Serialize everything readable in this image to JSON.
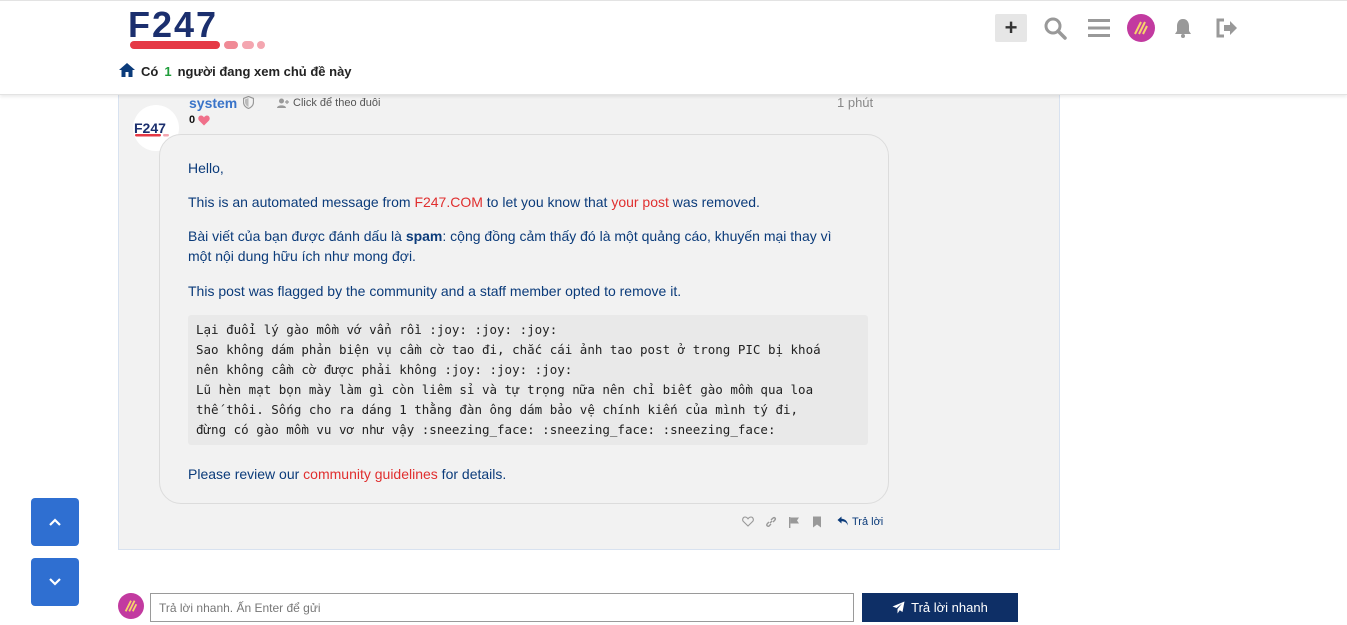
{
  "header": {
    "viewers_prefix": "Có",
    "viewers_count": "1",
    "viewers_suffix": "người đang xem chủ đề này",
    "icons": [
      "plus-icon",
      "search-icon",
      "menu-icon",
      "user-avatar",
      "bell-icon",
      "logout-icon"
    ],
    "plus_label": "+"
  },
  "post": {
    "username": "system",
    "follow_label": "Click để theo đuôi",
    "time": "1 phút",
    "likes": "0",
    "greeting": "Hello,",
    "msg1_a": "This is an automated message from ",
    "msg1_link1": "F247.COM",
    "msg1_b": " to let you know that ",
    "msg1_link2": "your post",
    "msg1_c": " was removed.",
    "msg2_a": "Bài viết của bạn được đánh dấu là ",
    "msg2_bold": "spam",
    "msg2_b": ": cộng đồng cảm thấy đó là một quảng cáo, khuyến mại thay vì",
    "msg2_c": "một nội dung hữu ích như mong đợi.",
    "msg3": "This post was flagged by the community and a staff member opted to remove it.",
    "quote": "Lại đuổi lý gào mồm vớ vẩn rồi :joy: :joy: :joy:\nSao không dám phản biện vụ cầm cờ tao đi, chắc cái ảnh tao post ở trong PIC bị khoá\nnên không cầm cờ được phải không :joy: :joy: :joy:\nLũ hèn mạt bọn mày làm gì còn liêm sỉ và tự trọng nữa nên chỉ biết gào mồm qua loa\nthế thôi. Sống cho ra dáng 1 thằng đàn ông dám bảo vệ chính kiến của mình tý đi,\nđừng có gào mồm vu vơ như vậy :sneezing_face: :sneezing_face: :sneezing_face:",
    "msg4_a": "Please review our ",
    "msg4_link": "community guidelines",
    "msg4_b": " for details.",
    "reply_label": "Trả lời"
  },
  "quick_reply": {
    "placeholder": "Trả lời nhanh. Ấn Enter để gửi",
    "button_label": "Trả lời nhanh"
  },
  "colors": {
    "accent": "#2f6fd1",
    "navy": "#0e2f66",
    "link_red": "#e02f2f",
    "text": "#0b3b7a"
  }
}
